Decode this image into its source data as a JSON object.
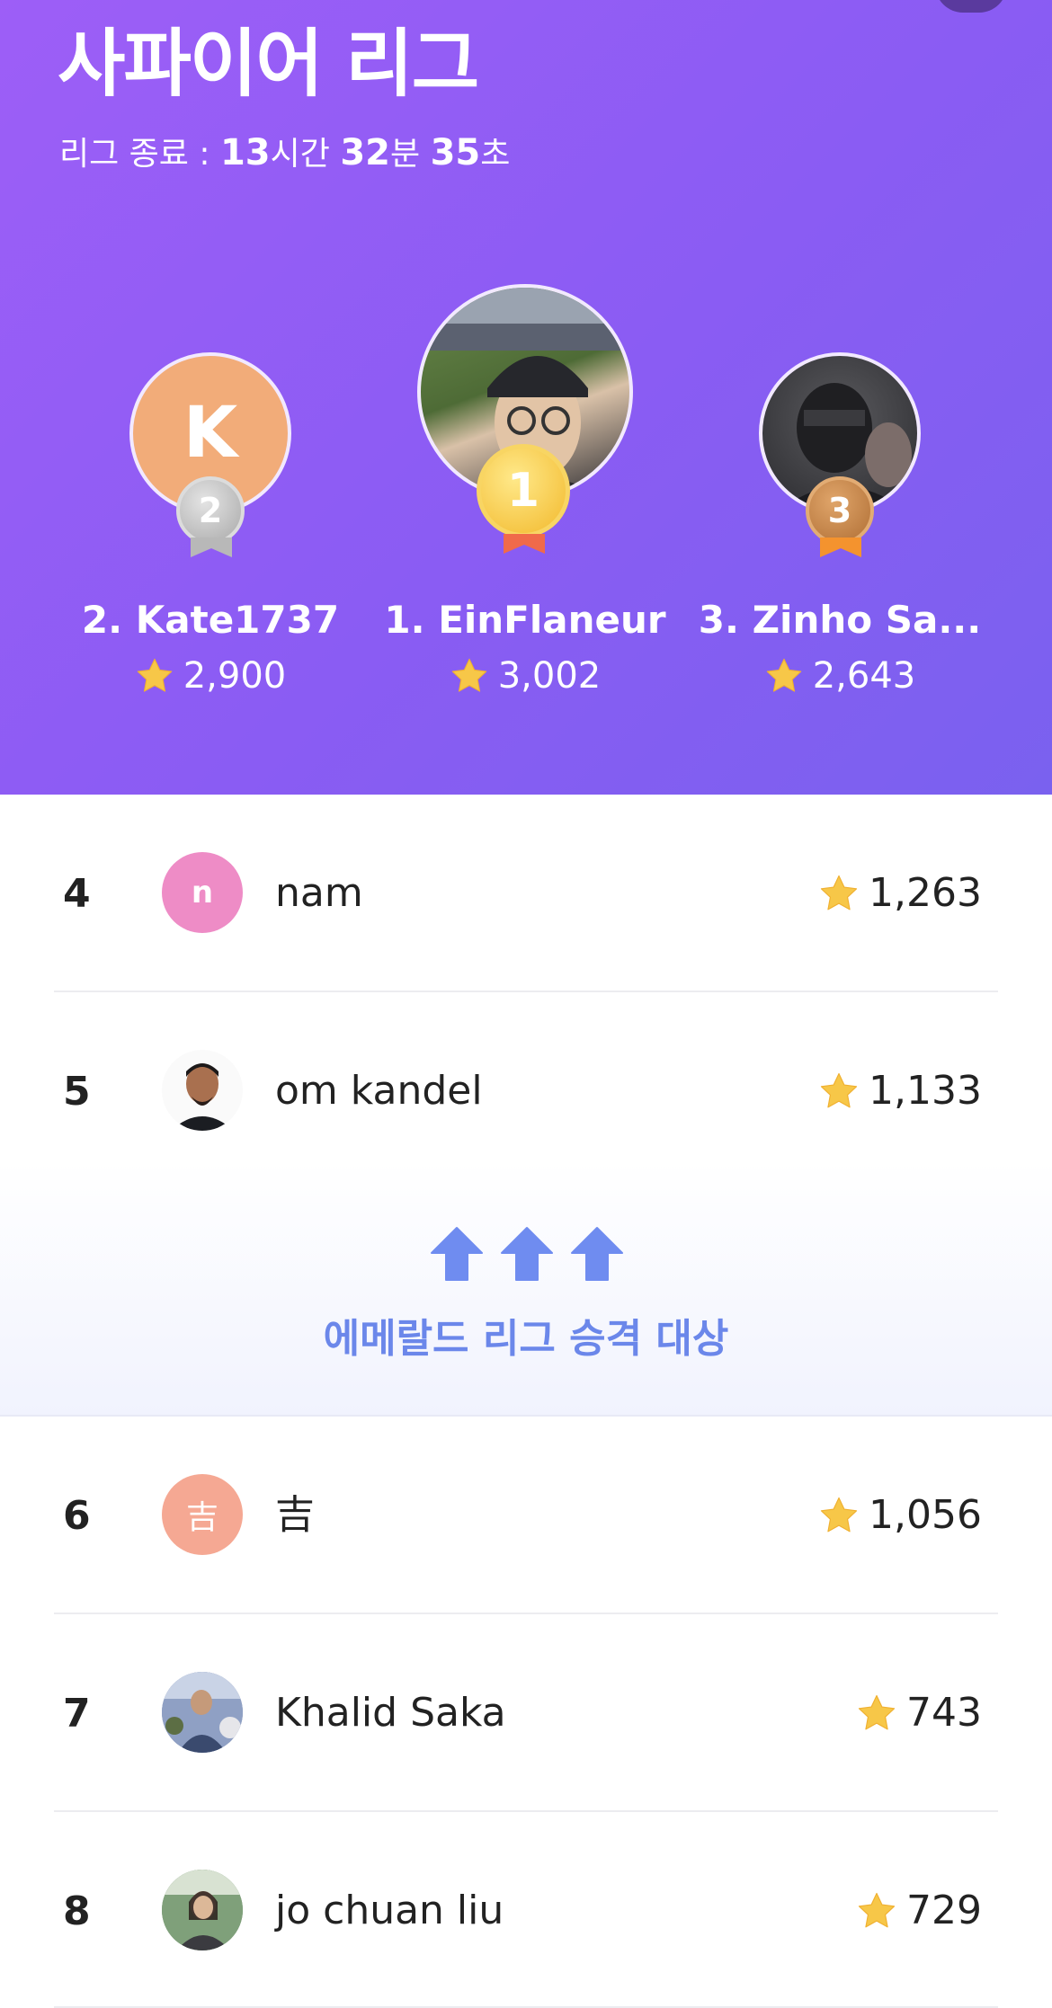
{
  "league": {
    "title": "사파이어 리그",
    "countdown_label": "리그 종료 : ",
    "hours": "13",
    "hours_unit": "시간 ",
    "minutes": "32",
    "minutes_unit": "분 ",
    "seconds": "35",
    "seconds_unit": "초"
  },
  "podium": [
    {
      "rank": "2",
      "name": "2. Kate1737",
      "score": "2,900",
      "avatar_initial": "K",
      "avatar_color": "#f2ac79",
      "medal": "silver"
    },
    {
      "rank": "1",
      "name": "1. EinFlaneur",
      "score": "3,002",
      "avatar_initial": "",
      "avatar_color": "#4f6b3a",
      "medal": "gold"
    },
    {
      "rank": "3",
      "name": "3. Zinho Sa...",
      "score": "2,643",
      "avatar_initial": "",
      "avatar_color": "#3a3a3e",
      "medal": "bronze"
    }
  ],
  "rows": [
    {
      "rank": "4",
      "name": "nam",
      "score": "1,263",
      "avatar_initial": "n",
      "avatar_color": "#ee8cc6",
      "avatar_type": "initial"
    },
    {
      "rank": "5",
      "name": "om kandel",
      "score": "1,133",
      "avatar_initial": "",
      "avatar_color": "#ffffff",
      "avatar_type": "photo"
    },
    {
      "rank": "6",
      "name": "吉",
      "score": "1,056",
      "avatar_initial": "吉",
      "avatar_color": "#f5a893",
      "avatar_type": "initial"
    },
    {
      "rank": "7",
      "name": "Khalid Saka",
      "score": "743",
      "avatar_initial": "",
      "avatar_color": "#7a8bb0",
      "avatar_type": "photo"
    },
    {
      "rank": "8",
      "name": "jo chuan liu",
      "score": "729",
      "avatar_initial": "",
      "avatar_color": "#6f8f6a",
      "avatar_type": "photo"
    }
  ],
  "promotion": {
    "text": "에메랄드 리그 승격 대상"
  },
  "colors": {
    "header_purple": "#9360f5",
    "promo_blue": "#6b87ea",
    "star_gold": "#f7c748",
    "gold_medal": "#f6c63e",
    "silver_medal": "#c4c4c4",
    "bronze_medal": "#c88548"
  }
}
